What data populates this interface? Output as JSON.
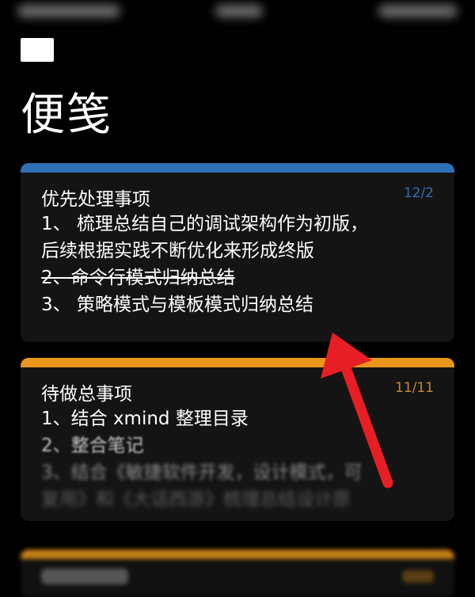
{
  "header": {
    "title": "便笺"
  },
  "colors": {
    "blue_accent": "#2f6fb5",
    "orange_accent": "#e8961c",
    "blue_date": "#2f6fb5",
    "orange_date": "#c98a2a",
    "arrow": "#e81e25"
  },
  "notes": [
    {
      "title": "优先处理事项",
      "date": "12/2",
      "lines": [
        "1、 梳理总结自己的调试架构作为初版，",
        "后续根据实践不断优化来形成终版",
        "2、命令行模式归纳总结",
        "3、 策略模式与模板模式归纳总结"
      ]
    },
    {
      "title": "待做总事项",
      "date": "11/11",
      "lines": [
        "1、结合 xmind 整理目录",
        "2、整合笔记",
        "3、结合《敏捷软件开发，设计模式，可",
        "复用》和《大话西游》梳理总结设计原"
      ]
    }
  ]
}
